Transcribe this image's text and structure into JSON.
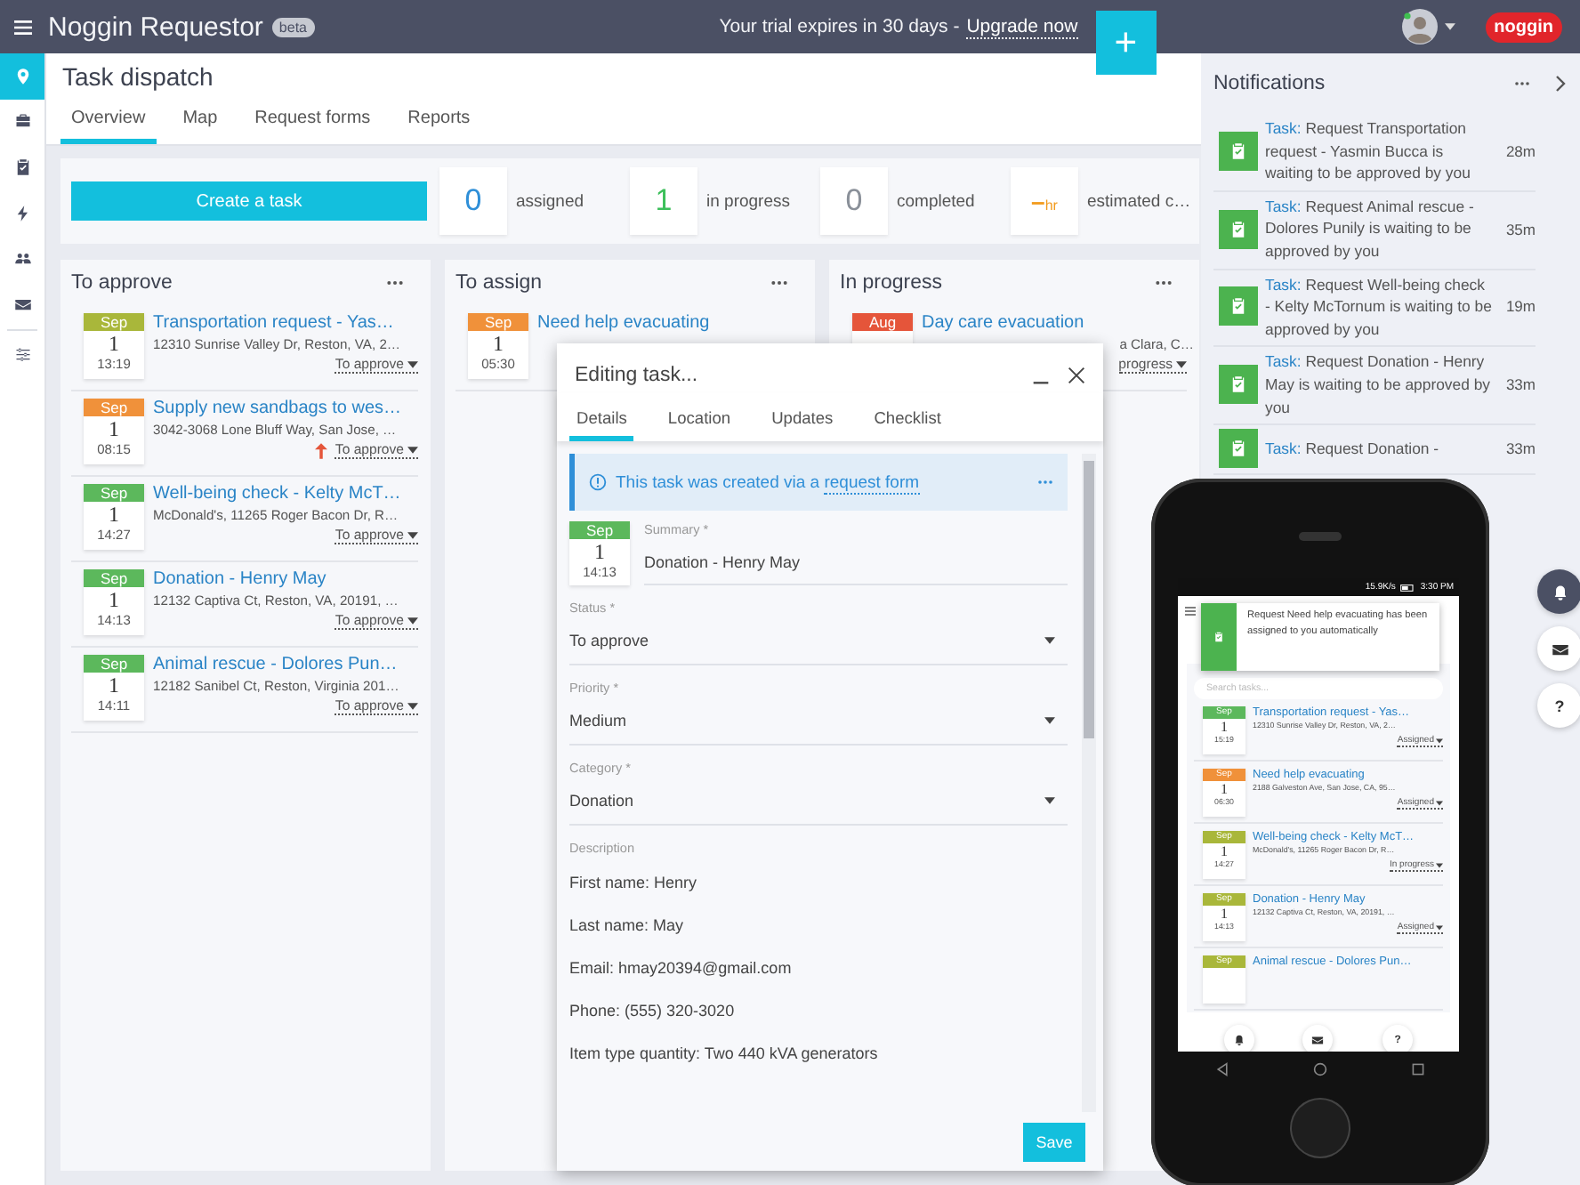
{
  "app": {
    "title": "Noggin Requestor",
    "badge": "beta",
    "trial_text": "Your trial expires in 30 days -",
    "upgrade_link": "Upgrade now",
    "add_button": "+",
    "logo": "noggin"
  },
  "rail": [
    {
      "kind": "pin",
      "selected": true
    },
    {
      "kind": "briefcase",
      "selected": false
    },
    {
      "kind": "clipboard",
      "selected": false
    },
    {
      "kind": "bolt",
      "selected": false
    },
    {
      "kind": "people",
      "selected": false
    },
    {
      "kind": "mail",
      "selected": false
    },
    {
      "kind": "sliders",
      "selected": false
    }
  ],
  "page": {
    "title": "Task dispatch",
    "tabs": [
      {
        "label": "Overview",
        "selected": true
      },
      {
        "label": "Map",
        "selected": false
      },
      {
        "label": "Request forms",
        "selected": false
      },
      {
        "label": "Reports",
        "selected": false
      }
    ]
  },
  "create_button": "Create a task",
  "stats": [
    {
      "value": "0",
      "label": "assigned",
      "color": "#2f8fd8"
    },
    {
      "value": "1",
      "label": "in progress",
      "color": "#3cbf5a"
    },
    {
      "value": "0",
      "label": "completed",
      "color": "#8a9099"
    },
    {
      "value": "–",
      "unit": "hr",
      "label": "estimated c…",
      "color": "#f29b1d"
    }
  ],
  "columns": [
    {
      "title": "To approve",
      "cards": [
        {
          "kind": "full",
          "month": "Sep",
          "day": "1",
          "time": "13:19",
          "color": "#a9b73a",
          "title": "Transportation request - Yas…",
          "address": "12310 Sunrise Valley Dr, Reston, VA, 2…",
          "status": "To approve",
          "urgent": false
        },
        {
          "kind": "full",
          "month": "Sep",
          "day": "1",
          "time": "08:15",
          "color": "#f0913a",
          "title": "Supply new sandbags to wes…",
          "address": "3042-3068 Lone Bluff Way, San Jose, …",
          "status": "To approve",
          "urgent": true
        },
        {
          "kind": "full",
          "month": "Sep",
          "day": "1",
          "time": "14:27",
          "color": "#5cb85c",
          "title": "Well-being check - Kelty McT…",
          "address": "McDonald's, 11265 Roger Bacon Dr, R…",
          "status": "To approve",
          "urgent": false
        },
        {
          "kind": "full",
          "month": "Sep",
          "day": "1",
          "time": "14:13",
          "color": "#5cb85c",
          "title": "Donation - Henry May",
          "address": "12132 Captiva Ct, Reston, VA, 20191, …",
          "status": "To approve",
          "urgent": false
        },
        {
          "kind": "full",
          "month": "Sep",
          "day": "1",
          "time": "14:11",
          "color": "#5cb85c",
          "title": "Animal rescue - Dolores Pun…",
          "address": "12182 Sanibel Ct, Reston, Virginia 201…",
          "status": "To approve",
          "urgent": false
        }
      ]
    },
    {
      "title": "To assign",
      "cards": [
        {
          "kind": "full",
          "month": "Sep",
          "day": "1",
          "time": "05:30",
          "color": "#f0913a",
          "title": "Need help evacuating",
          "urgent": false
        }
      ]
    },
    {
      "title": "In progress",
      "cards": [
        {
          "kind": "covered",
          "month": "Aug",
          "color": "#e5553a",
          "title": "Day care evacuation",
          "address": "a Clara, C…",
          "status": "progress",
          "urgent": false
        }
      ]
    }
  ],
  "notifications": {
    "title": "Notifications",
    "items": [
      {
        "label": "Task:",
        "text": "Request Transportation request - Yasmin Bucca is waiting to be approved by you",
        "time": "28m"
      },
      {
        "label": "Task:",
        "text": "Request Animal rescue - Dolores Punily is waiting to be approved by you",
        "time": "35m"
      },
      {
        "label": "Task:",
        "text": "Request Well-being check - Kelty McTornum is waiting to be approved by you",
        "time": "19m"
      },
      {
        "label": "Task:",
        "text": "Request Donation - Henry May is waiting to be approved by you",
        "time": "33m"
      },
      {
        "label": "Task:",
        "text": "Request Donation -",
        "time": "33m"
      }
    ]
  },
  "side_buttons": [
    {
      "kind": "bell",
      "selected": true
    },
    {
      "kind": "mail",
      "selected": false
    },
    {
      "kind": "help",
      "label": "?",
      "selected": false
    }
  ],
  "dialog": {
    "title": "Editing task...",
    "tabs": [
      {
        "label": "Details",
        "selected": true
      },
      {
        "label": "Location",
        "selected": false
      },
      {
        "label": "Updates",
        "selected": false
      },
      {
        "label": "Checklist",
        "selected": false
      }
    ],
    "notice": "This task was created via a",
    "notice_link": "request form",
    "date": {
      "month": "Sep",
      "day": "1",
      "time": "14:13",
      "color": "#5cb85c"
    },
    "summary": {
      "label": "Summary *",
      "value": "Donation - Henry May"
    },
    "selects": [
      {
        "label": "Status *",
        "value": "To approve"
      },
      {
        "label": "Priority *",
        "value": "Medium"
      },
      {
        "label": "Category *",
        "value": "Donation"
      }
    ],
    "description_label": "Description",
    "description": [
      "First name: Henry",
      "Last name: May",
      "Email: hmay20394@gmail.com",
      "Phone: (555) 320-3020",
      "Item type quantity: Two 440 kVA generators"
    ],
    "save_button": "Save"
  },
  "phone": {
    "speed": "15.9K/s",
    "clock": "3:30 PM",
    "toast": "Request Need help evacuating has been assigned to you automatically",
    "search_placeholder": "Search tasks...",
    "cards": [
      {
        "month": "Sep",
        "day": "1",
        "time": "15:19",
        "color": "#5cb85c",
        "title": "Transportation request - Yas…",
        "address": "12310 Sunrise Valley Dr, Reston, VA, 2…",
        "status": "Assigned"
      },
      {
        "month": "Sep",
        "day": "1",
        "time": "06:30",
        "color": "#f0913a",
        "title": "Need help evacuating",
        "address": "2188 Galveston Ave, San Jose, CA, 95…",
        "status": "Assigned"
      },
      {
        "month": "Sep",
        "day": "1",
        "time": "14:27",
        "color": "#a9b73a",
        "title": "Well-being check - Kelty McT…",
        "address": "McDonald's, 11265 Roger Bacon Dr, R…",
        "status": "In progress"
      },
      {
        "month": "Sep",
        "day": "1",
        "time": "14:13",
        "color": "#a9b73a",
        "title": "Donation - Henry May",
        "address": "12132 Captiva Ct, Reston, VA, 20191, …",
        "status": "Assigned"
      },
      {
        "month": "Sep",
        "color": "#a9b73a",
        "title": "Animal rescue - Dolores Pun…"
      }
    ],
    "bottom_buttons": [
      {
        "kind": "bell"
      },
      {
        "kind": "mail"
      },
      {
        "kind": "help",
        "label": "?"
      }
    ]
  }
}
